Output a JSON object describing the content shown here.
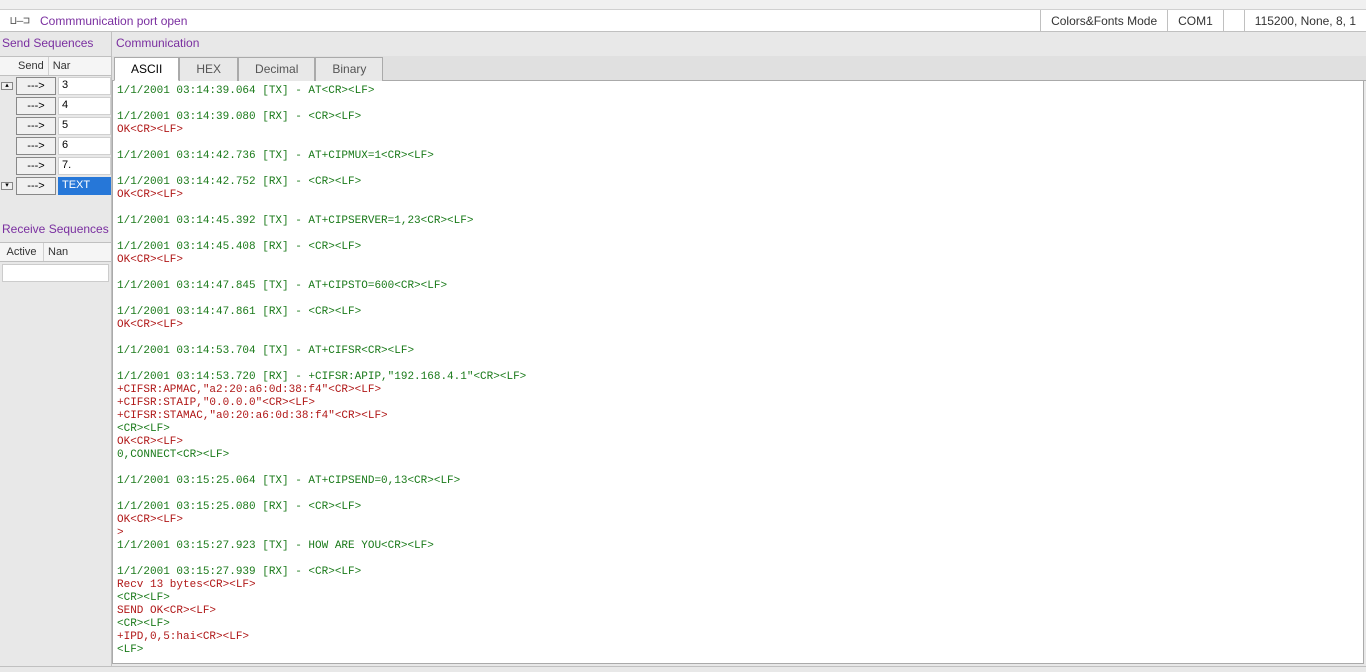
{
  "status": {
    "port_glyph": "⊔—⊐",
    "text": "Commmunication port open",
    "colors_mode": "Colors&Fonts Mode",
    "com_port": "COM1",
    "settings": "115200, None, 8, 1"
  },
  "send_sequences": {
    "title": "Send Sequences",
    "col_send": "Send",
    "col_name": "Nar",
    "send_btn_label": "--->",
    "rows": [
      "3",
      "4",
      "5",
      "6",
      "7.",
      "TEXT"
    ],
    "selected_index": 5
  },
  "receive_sequences": {
    "title": "Receive Sequences",
    "col_active": "Active",
    "col_name": "Nan"
  },
  "communication": {
    "title": "Communication",
    "tabs": [
      "ASCII",
      "HEX",
      "Decimal",
      "Binary"
    ],
    "active_tab": 0
  },
  "terminal": [
    {
      "cls": "tx",
      "text": "1/1/2001 03:14:39.064 [TX] - AT<CR><LF>"
    },
    {
      "cls": "",
      "text": ""
    },
    {
      "cls": "rx",
      "text": "1/1/2001 03:14:39.080 [RX] - <CR><LF>"
    },
    {
      "cls": "ok",
      "text": "OK<CR><LF>"
    },
    {
      "cls": "",
      "text": ""
    },
    {
      "cls": "tx",
      "text": "1/1/2001 03:14:42.736 [TX] - AT+CIPMUX=1<CR><LF>"
    },
    {
      "cls": "",
      "text": ""
    },
    {
      "cls": "rx",
      "text": "1/1/2001 03:14:42.752 [RX] - <CR><LF>"
    },
    {
      "cls": "ok",
      "text": "OK<CR><LF>"
    },
    {
      "cls": "",
      "text": ""
    },
    {
      "cls": "tx",
      "text": "1/1/2001 03:14:45.392 [TX] - AT+CIPSERVER=1,23<CR><LF>"
    },
    {
      "cls": "",
      "text": ""
    },
    {
      "cls": "rx",
      "text": "1/1/2001 03:14:45.408 [RX] - <CR><LF>"
    },
    {
      "cls": "ok",
      "text": "OK<CR><LF>"
    },
    {
      "cls": "",
      "text": ""
    },
    {
      "cls": "tx",
      "text": "1/1/2001 03:14:47.845 [TX] - AT+CIPSTO=600<CR><LF>"
    },
    {
      "cls": "",
      "text": ""
    },
    {
      "cls": "rx",
      "text": "1/1/2001 03:14:47.861 [RX] - <CR><LF>"
    },
    {
      "cls": "ok",
      "text": "OK<CR><LF>"
    },
    {
      "cls": "",
      "text": ""
    },
    {
      "cls": "tx",
      "text": "1/1/2001 03:14:53.704 [TX] - AT+CIFSR<CR><LF>"
    },
    {
      "cls": "",
      "text": ""
    },
    {
      "cls": "rx",
      "text": "1/1/2001 03:14:53.720 [RX] - +CIFSR:APIP,\"192.168.4.1\"<CR><LF>"
    },
    {
      "cls": "err",
      "text": "+CIFSR:APMAC,\"a2:20:a6:0d:38:f4\"<CR><LF>"
    },
    {
      "cls": "err",
      "text": "+CIFSR:STAIP,\"0.0.0.0\"<CR><LF>"
    },
    {
      "cls": "err",
      "text": "+CIFSR:STAMAC,\"a0:20:a6:0d:38:f4\"<CR><LF>"
    },
    {
      "cls": "rx",
      "text": "<CR><LF>"
    },
    {
      "cls": "ok",
      "text": "OK<CR><LF>"
    },
    {
      "cls": "rx",
      "text": "0,CONNECT<CR><LF>"
    },
    {
      "cls": "",
      "text": ""
    },
    {
      "cls": "tx",
      "text": "1/1/2001 03:15:25.064 [TX] - AT+CIPSEND=0,13<CR><LF>"
    },
    {
      "cls": "",
      "text": ""
    },
    {
      "cls": "rx",
      "text": "1/1/2001 03:15:25.080 [RX] - <CR><LF>"
    },
    {
      "cls": "ok",
      "text": "OK<CR><LF>"
    },
    {
      "cls": "ok",
      "text": ">"
    },
    {
      "cls": "tx",
      "text": "1/1/2001 03:15:27.923 [TX] - HOW ARE YOU<CR><LF>"
    },
    {
      "cls": "",
      "text": ""
    },
    {
      "cls": "rx",
      "text": "1/1/2001 03:15:27.939 [RX] - <CR><LF>"
    },
    {
      "cls": "err",
      "text": "Recv 13 bytes<CR><LF>"
    },
    {
      "cls": "rx",
      "text": "<CR><LF>"
    },
    {
      "cls": "ok",
      "text": "SEND OK<CR><LF>"
    },
    {
      "cls": "rx",
      "text": "<CR><LF>"
    },
    {
      "cls": "err",
      "text": "+IPD,0,5:hai<CR><LF>"
    },
    {
      "cls": "rx",
      "text": "<LF>"
    }
  ]
}
